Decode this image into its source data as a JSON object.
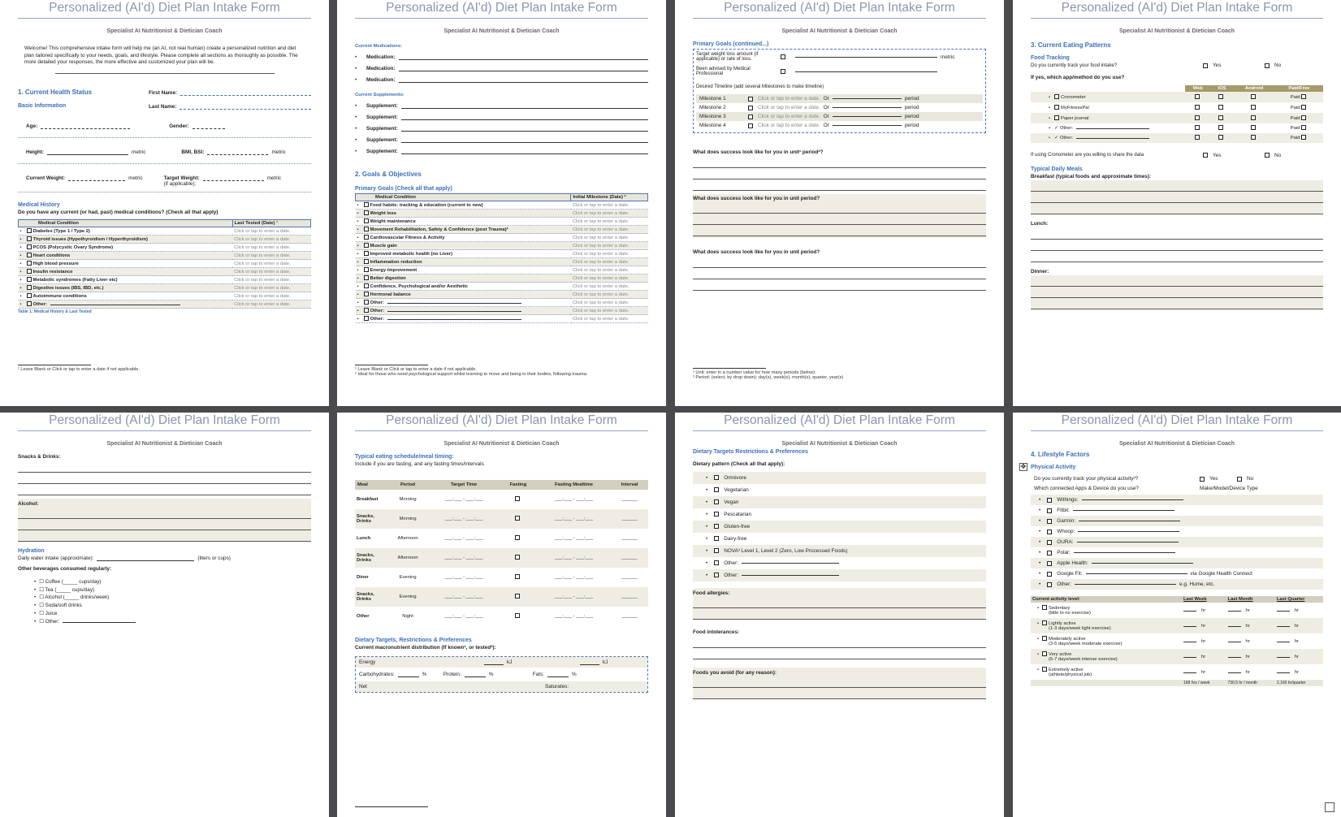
{
  "header_title": "Personalized (AI'd) Diet Plan Intake Form",
  "subheader": "Specialist AI Nutritionist & Dietician Coach",
  "placeholder": "Click or tap to enter a date.",
  "p1": {
    "intro": "Welcome! This comprehensive intake form will help me (an AI, not real human) create a personalized nutrition and diet plan tailored specifically to your needs, goals, and lifestyle. Please complete all sections as thoroughly as possible. The more detailed your responses, the more effective and customized your plan will be.",
    "s1": "1. Current Health Status",
    "basic": "Basic Information",
    "first": "First Name:",
    "last": "Last Name:",
    "age": "Age:",
    "gender": "Gender:",
    "height": "Height:",
    "metric": "metric",
    "bmi": "BMI, BSI:",
    "cw": "Current Weight:",
    "tw": "Target Weight:",
    "tw_note": "(if applicable):",
    "mh": "Medical History",
    "mh_q": "Do you have any current (or had, past) medical conditions? (Check all that apply)",
    "col1": "Medical Condition",
    "col2": "Last Tested (Date) ¹",
    "conditions": [
      "Diabetes (Type 1 / Type 2)",
      "Thyroid issues (Hypothyroidism / Hyperthyroidism)",
      "PCOS (Polycystic Ovary Syndrome)",
      "Heart conditions",
      "High blood pressure",
      "Insulin resistance",
      "Metabolic syndromes (Fatty Liver etc)",
      "Digestive issues (IBS, IBD, etc.)",
      "Autoimmune conditions",
      "Other:"
    ],
    "caption": "Table 1: Medical History & Last Tested",
    "foot": "¹ Leave Blank or Click or tap to enter a date if not applicable."
  },
  "p2": {
    "meds": "Current Medications:",
    "med": "Medication:",
    "supps": "Current Supplements:",
    "supp": "Supplement:",
    "s2": "2. Goals & Objectives",
    "pg": "Primary Goals (Check all that apply)",
    "col1": "Medical Condition",
    "col2": "Initial Milestone (Date) ²",
    "goals": [
      "Food habits: tracking & education (current to new)",
      "Weight loss",
      "Weight maintenance",
      "Movement Rehabilitation, Safety & Confidence (post Trauma)²",
      "Cardiovascular Fitness & Activity",
      "Muscle gain",
      "Improved metabolic health (no Liver)",
      "Inflammation reduction",
      "Energy improvement",
      "Better digestion",
      "Confidence, Psychological and/or Aesthetic",
      "Hormonal balance",
      "Other:",
      "Other:",
      "Other:"
    ],
    "foot1": "¹ Leave Blank or Click or tap to enter a date if not applicable.",
    "foot2": "² Ideal for those who need psychological support whilst learning to move and being in their bodies, following trauma."
  },
  "p3": {
    "pgc": "Primary Goals (continued...)",
    "twl": "Target weight loss amount (if applicable) or rate of loss.",
    "metric": "metric",
    "adv": "Been advised by Medical Professional",
    "timeline": "Desired Timeline (add several Milestones to make timeline)",
    "milestones": [
      "Milestone 1",
      "Milestone 2",
      "Milestone 3",
      "Milestone 4"
    ],
    "or": "Or",
    "period": "period",
    "q1": "What does success look like for you in unit¹ period²?",
    "q2": "What does success look like for you in unit period?",
    "q3": "What does success look like for you in unit period?",
    "foot1": "¹ Unit: enter in a number value for how many periods (below):",
    "foot2": "² Period: (select, by drop down): day(s), week(s), month(s), quarter, year(s)"
  },
  "p4": {
    "s3": "3. Current Eating Patterns",
    "ft": "Food Tracking",
    "q": "Do you currently track your food intake?",
    "yes": "Yes",
    "no": "No",
    "which": "If yes, which app/method do you use?",
    "cols": [
      "Web",
      "iOS",
      "Android",
      "Paid/Free"
    ],
    "apps": [
      "Cronometer",
      "MyFitnessPal",
      "Paper journal",
      "Other:",
      "Other:"
    ],
    "paid": "Paid:",
    "share": "If using Cronometer are you willing to share the data",
    "tdm": "Typical Daily Meals",
    "bf": "Breakfast (typical foods and approximate times):",
    "lunch": "Lunch:",
    "dinner": "Dinner:"
  },
  "p5": {
    "snacks": "Snacks & Drinks:",
    "alcohol": "Alcohol:",
    "hyd": "Hydration",
    "water": "Daily water intake (approximate):",
    "units": "(liters or cups)",
    "other": "Other beverages consumed regularly:",
    "bev": [
      "Coffee (_____ cups/day)",
      "Tea (_____ cups/day)",
      "Alcohol (_____ drinks/week)",
      "Soda/soft drinks",
      "Juice",
      "Other:"
    ]
  },
  "p6": {
    "sched": "Typical eating schedule/meal timing:",
    "note": "Include if you are fasting, and any fasting times/intervals",
    "cols": [
      "Meal",
      "Period",
      "Target Time",
      "Fasting",
      "Fasting Mealtime",
      "Interval"
    ],
    "meals": [
      [
        "Breakfast",
        "Morning"
      ],
      [
        "Snacks, Drinks",
        "Morning"
      ],
      [
        "Lunch",
        "Afternoon"
      ],
      [
        "Snacks, Drinks",
        "Afternoon"
      ],
      [
        "Diner",
        "Evening"
      ],
      [
        "Snacks, Drinks",
        "Evening"
      ],
      [
        "Other",
        "Night"
      ]
    ],
    "dt": "Dietary Targets, Restrictions & Preferences",
    "macro": "Current macronutrient distribution (If known¹, or tested²):",
    "energy": "Energy",
    "kj": "kJ",
    "carb": "Carbohydrates:",
    "prot": "Protein:",
    "fats": "Fats:",
    "pct": "%",
    "net": "Net",
    "sat": "Saturates:"
  },
  "p7": {
    "dtr": "Dietary Targets Restrictions & Preferences",
    "dp": "Dietary pattern (Check all that apply):",
    "patterns": [
      "Omnivore",
      "Vegetarian",
      "Vegan",
      "Pescatarian",
      "Gluten-free",
      "Dairy-free",
      "NOVA³ Level 1, Level 2 (Zero, Low Processed Foods)",
      "Other:",
      "Other:"
    ],
    "allergy": "Food allergies:",
    "intol": "Food intolerances:",
    "avoid": "Foods you avoid (for any reason):"
  },
  "p8": {
    "s4": "4. Lifestyle Factors",
    "pa": "Physical Activity",
    "q": "Do you currently track your physical activity³?",
    "yes": "Yes",
    "no": "No",
    "which": "Which connected Apps & Device do you use?",
    "make": "Make/Model/Device Type",
    "devices": [
      "Withings:",
      "Fitbit:",
      "Garmin:",
      "Whoop:",
      "OURA:",
      "Polar:",
      "Apple Health:",
      "Google Fit:",
      "Other:"
    ],
    "gfit_note": "via Google Health Connect",
    "other_note": "e.g. Hume, etc.",
    "cal": "Current activity level:",
    "cols": [
      "Last Week",
      "Last Month",
      "Last Quarter"
    ],
    "hr": "hr",
    "levels": [
      [
        "Sedentary",
        "(little to no exercise)"
      ],
      [
        "Lightly active",
        "(1-3 days/week light exercise)"
      ],
      [
        "Moderately active",
        "(3-5 days/week moderate exercise)"
      ],
      [
        "Very active",
        "(6-7 days/week intense exercise)"
      ],
      [
        "Extremely active",
        "(athlete/physical job)"
      ]
    ],
    "totals": [
      "168 hrs / week",
      "730.5 hr / month",
      "2,160 hr/quarter"
    ]
  }
}
